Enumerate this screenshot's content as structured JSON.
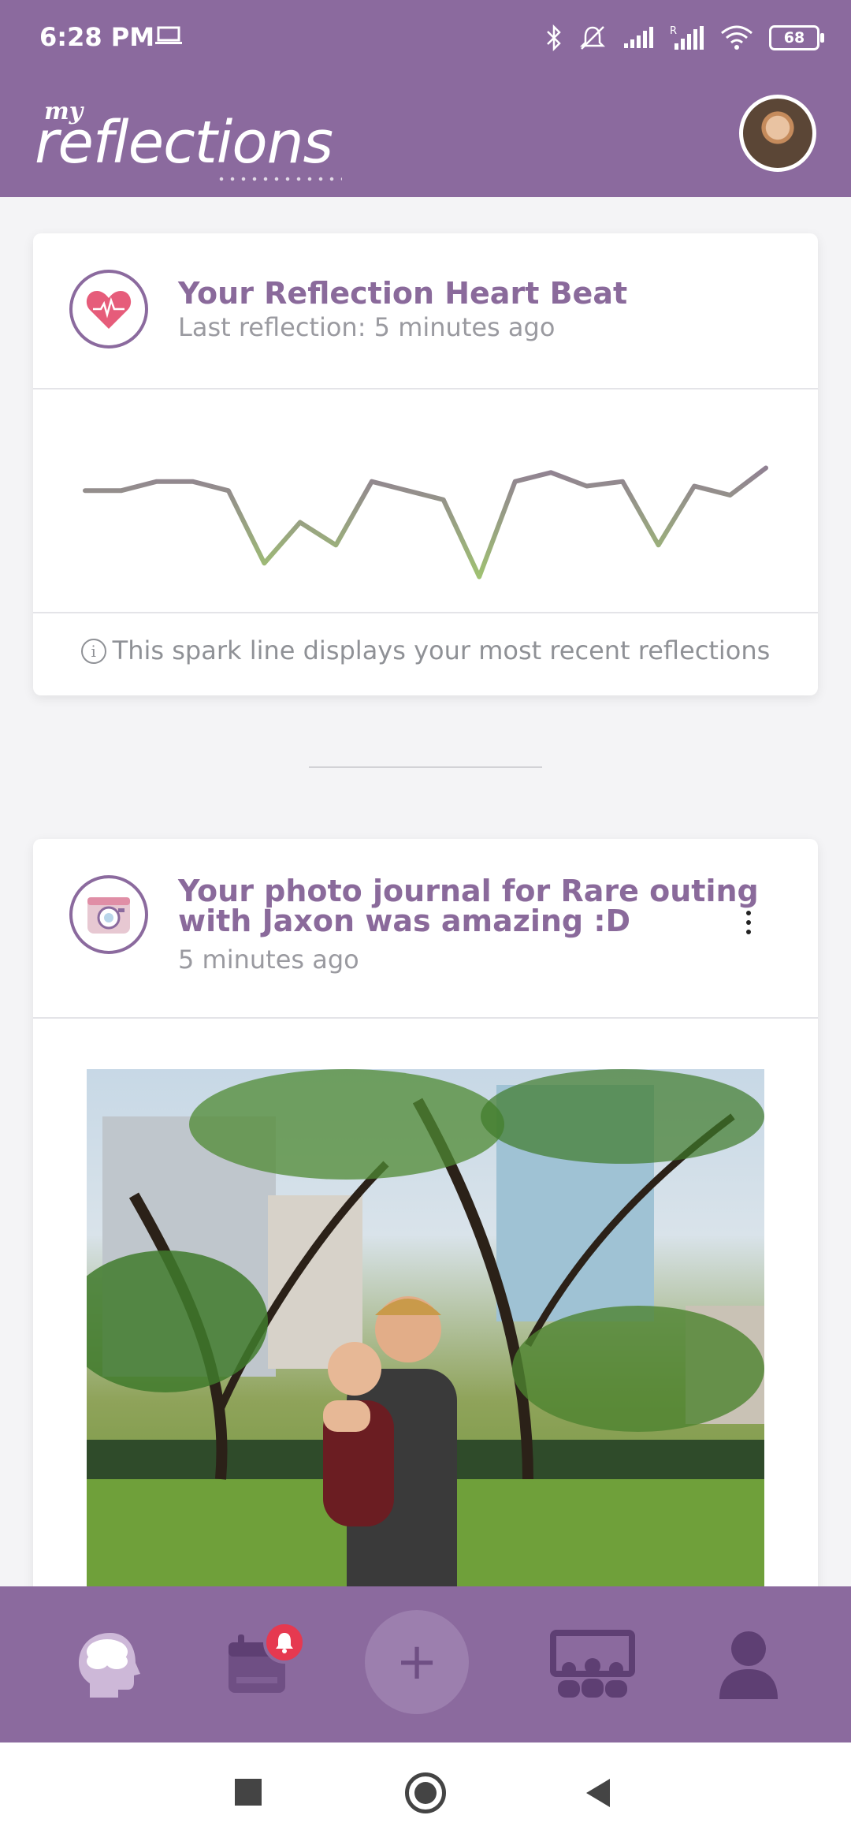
{
  "status_bar": {
    "time": "6:28 PM",
    "battery": "68",
    "icons": [
      "laptop-icon",
      "bluetooth-icon",
      "mute-icon",
      "signal-icon",
      "roaming-signal-icon",
      "wifi-icon",
      "battery-icon"
    ]
  },
  "app": {
    "logo_small": "my",
    "logo_main": "reflections"
  },
  "heartbeat_card": {
    "title": "Your Reflection Heart Beat",
    "subtitle": "Last reflection: 5 minutes ago",
    "hint": "This spark line displays your most recent reflections",
    "sparkline_values": [
      0.25,
      0.25,
      0.35,
      0.35,
      0.25,
      -0.55,
      -0.1,
      -0.35,
      0.35,
      0.25,
      0.15,
      -0.7,
      0.35,
      0.45,
      0.3,
      0.35,
      -0.35,
      0.3,
      0.2,
      0.5
    ],
    "line_color_high": "#8b6a9e",
    "line_color_low": "#a3d16a"
  },
  "journal_card": {
    "title_line1": "Your photo journal for Rare outing",
    "title_line2": "with Jaxon was amazing :D",
    "subtitle": "5 minutes ago"
  },
  "bottom_nav": {
    "items": [
      "brain-icon",
      "calendar-icon",
      "add-button",
      "group-icon",
      "profile-icon"
    ],
    "fab_label": "+"
  },
  "colors": {
    "primary": "#8b6a9e",
    "title": "#8a6a9b",
    "badge": "#e63950"
  }
}
